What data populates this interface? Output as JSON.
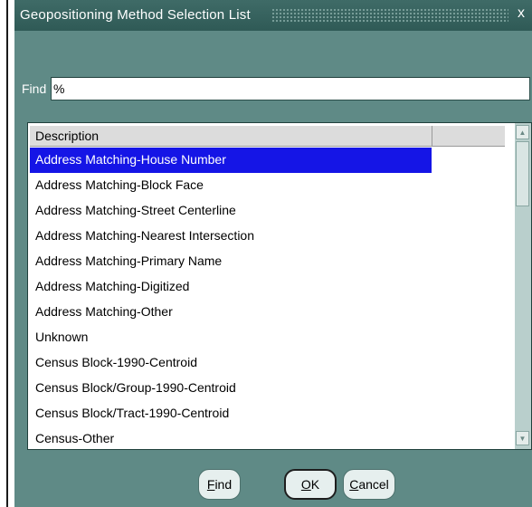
{
  "title": "Geopositioning Method Selection List",
  "close_glyph": "x",
  "find": {
    "label": "Find",
    "value": "%"
  },
  "list": {
    "header": "Description",
    "items": [
      "Address Matching-House Number",
      "Address Matching-Block Face",
      "Address Matching-Street Centerline",
      "Address Matching-Nearest Intersection",
      "Address Matching-Primary Name",
      "Address Matching-Digitized",
      "Address Matching-Other",
      "Unknown",
      "Census Block-1990-Centroid",
      "Census Block/Group-1990-Centroid",
      "Census Block/Tract-1990-Centroid",
      "Census-Other"
    ],
    "selected_index": 0
  },
  "buttons": {
    "find": {
      "mnemonic": "F",
      "rest": "ind"
    },
    "ok": {
      "mnemonic": "O",
      "rest": "K"
    },
    "cancel": {
      "mnemonic": "C",
      "rest": "ancel"
    }
  },
  "colors": {
    "dialog_bg": "#5f8a86",
    "title_bg": "#2f5a56",
    "selection": "#1515e6"
  },
  "icons": {
    "scroll_up": "scroll-up-arrow-icon",
    "scroll_down": "scroll-down-arrow-icon",
    "close": "close-icon"
  }
}
